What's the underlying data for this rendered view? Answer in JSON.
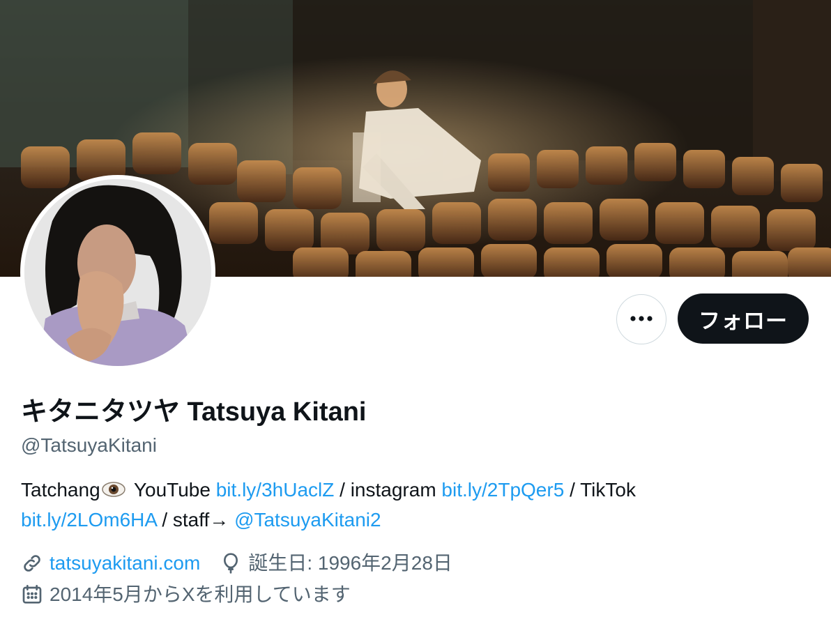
{
  "profile": {
    "display_name": "キタニタツヤ Tatsuya Kitani",
    "handle": "@TatsuyaKitani",
    "follow_label": "フォロー",
    "more_icon": "more-horizontal-icon"
  },
  "bio": {
    "text_1": "Tatchang",
    "text_2": "YouTube",
    "link_youtube": "bit.ly/3hUaclZ",
    "text_3": "/ instagram",
    "link_instagram": "bit.ly/2TpQer5",
    "text_4": "/ TikTok",
    "link_tiktok": "bit.ly/2LOm6HA",
    "text_5": "/ staff→",
    "link_staff": "@TatsuyaKitani2"
  },
  "meta": {
    "website": "tatsuyakitani.com",
    "birthday": "誕生日: 1996年2月28日",
    "joined": "2014年5月からXを利用しています",
    "website_icon": "link-icon",
    "birthday_icon": "balloon-icon",
    "joined_icon": "calendar-icon"
  },
  "colors": {
    "link": "#1d9bf0",
    "secondary_text": "#536471",
    "follow_bg": "#0f1419"
  }
}
